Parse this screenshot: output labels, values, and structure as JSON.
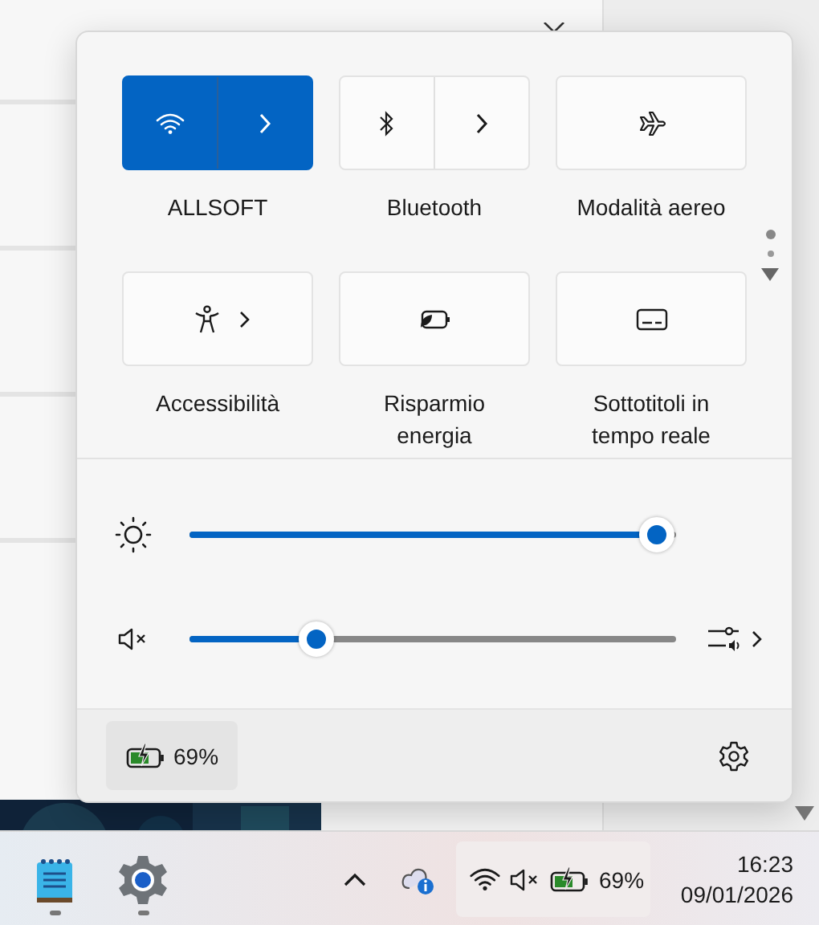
{
  "quick_settings": {
    "tiles": [
      {
        "kind": "wifi",
        "label": "ALLSOFT",
        "on": true
      },
      {
        "kind": "bluetooth",
        "label": "Bluetooth",
        "on": false
      },
      {
        "kind": "airplane",
        "label": "Modalità aereo",
        "on": false
      },
      {
        "kind": "accessibility",
        "label": "Accessibilità",
        "on": false
      },
      {
        "kind": "battery-saver",
        "label": "Risparmio energia",
        "on": false
      },
      {
        "kind": "captions",
        "label": "Sottotitoli in tempo reale",
        "on": false
      }
    ],
    "pages": [
      {
        "selected": true
      },
      {
        "selected": false
      }
    ],
    "sliders": [
      {
        "kind": "brightness",
        "level": 0.96
      },
      {
        "kind": "volume",
        "level": 0.26,
        "muted": true
      }
    ],
    "footer": {
      "battery": "69%"
    }
  },
  "taskbar": {
    "apps": [
      {
        "kind": "notepad",
        "running": true
      },
      {
        "kind": "settings",
        "running": true
      }
    ],
    "tray": {
      "battery": "69%",
      "muted": true
    },
    "clock": {
      "time": "16:23",
      "date": "09/01/2026"
    }
  }
}
